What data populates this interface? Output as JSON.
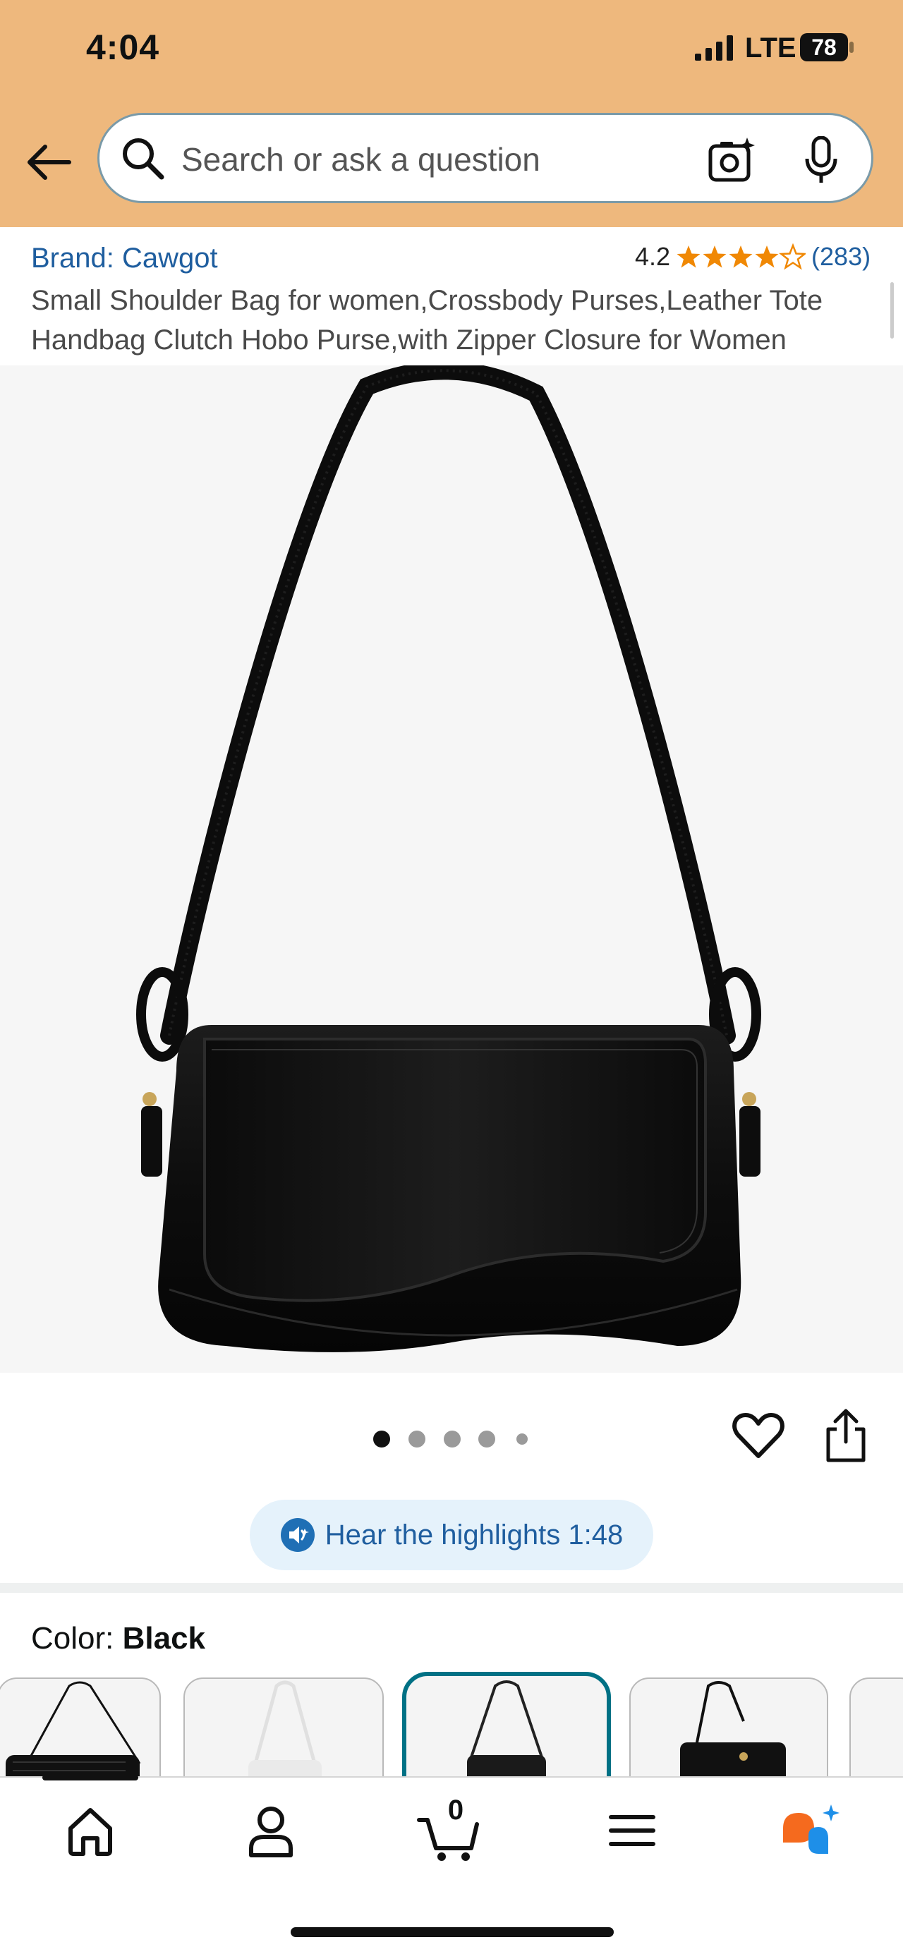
{
  "status_bar": {
    "time": "4:04",
    "network": "LTE",
    "battery": "78"
  },
  "search": {
    "placeholder": "Search or ask a question"
  },
  "product": {
    "brand": "Brand: Cawgot",
    "rating": "4.2",
    "reviews": "(283)",
    "stars_filled": 4.2,
    "title": "Small Shoulder Bag for women,Crossbody Purses,Leather Tote Handbag Clutch Hobo Purse,with Zipper Closure for Women"
  },
  "image_carousel": {
    "total_dots": 5,
    "active_index": 0
  },
  "highlights": {
    "label": "Hear the highlights 1:48"
  },
  "color": {
    "label": "Color: ",
    "value": "Black"
  },
  "swatches": [
    "black-croc",
    "white",
    "black-selected",
    "black-flap",
    "partial"
  ],
  "bottom_nav": {
    "cart_count": "0"
  },
  "colors": {
    "header_bg": "#eeb87d",
    "link": "#1f5e9f",
    "star": "#f08804",
    "selected": "#007185"
  }
}
